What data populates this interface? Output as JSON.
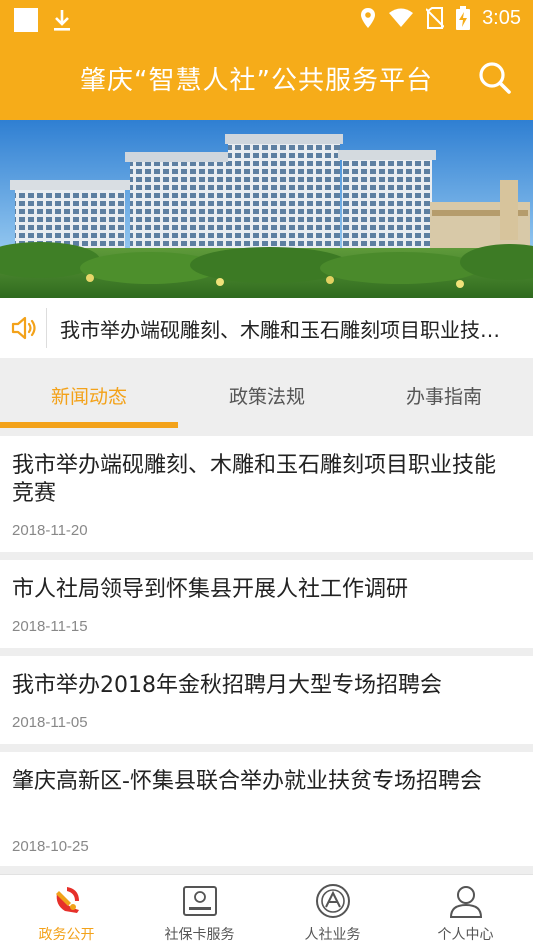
{
  "status_bar": {
    "time": "3:05"
  },
  "app_bar": {
    "title": "肇庆“智慧人社”公共服务平台",
    "search_icon": "search-icon"
  },
  "notice": {
    "icon": "speaker-icon",
    "text": "我市举办端砚雕刻、木雕和玉石雕刻项目职业技能竞赛"
  },
  "tabs": [
    {
      "label": "新闻动态",
      "active": true
    },
    {
      "label": "政策法规",
      "active": false
    },
    {
      "label": "办事指南",
      "active": false
    }
  ],
  "news": [
    {
      "title": "我市举办端砚雕刻、木雕和玉石雕刻项目职业技能竞赛",
      "date": "2018-11-20"
    },
    {
      "title": "市人社局领导到怀集县开展人社工作调研",
      "date": "2018-11-15"
    },
    {
      "title": "我市举办2018年金秋招聘月大型专场招聘会",
      "date": "2018-11-05"
    },
    {
      "title": "肇庆高新区-怀集县联合举办就业扶贫专场招聘会",
      "date": "2018-10-25"
    }
  ],
  "bottom_nav": [
    {
      "label": "政务公开",
      "icon": "party-emblem-icon",
      "active": true
    },
    {
      "label": "社保卡服务",
      "icon": "social-security-card-icon",
      "active": false
    },
    {
      "label": "人社业务",
      "icon": "hrss-emblem-icon",
      "active": false
    },
    {
      "label": "个人中心",
      "icon": "user-icon",
      "active": false
    }
  ],
  "colors": {
    "accent": "#f6ac19",
    "tab_active": "#f3a21a",
    "text": "#222222",
    "date": "#888888"
  }
}
